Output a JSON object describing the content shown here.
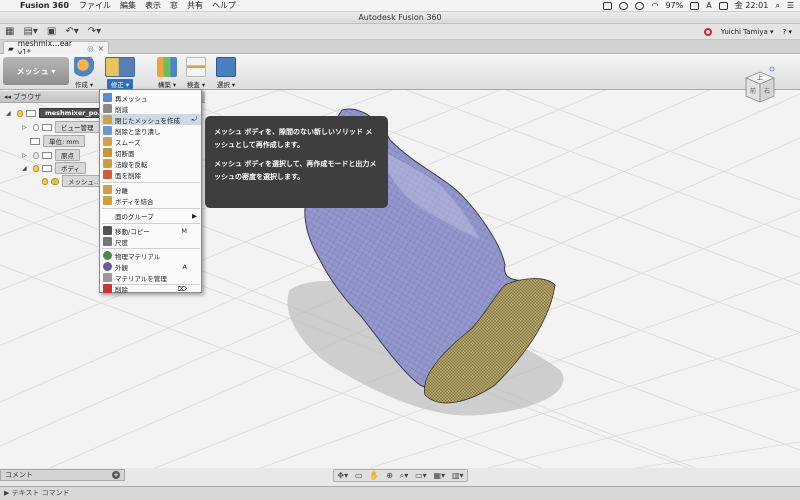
{
  "menubar": {
    "app_name": "Fusion 360",
    "items": [
      "ファイル",
      "編集",
      "表示",
      "窓",
      "共有",
      "ヘルプ"
    ],
    "battery": "97%",
    "input_mode": "A",
    "clock": "金 22:01"
  },
  "window": {
    "title": "Autodesk Fusion 360"
  },
  "qat": {
    "user": "Yuichi Tamiya ▾",
    "help": "? ▾"
  },
  "document_tab": {
    "label": "meshmix…ear v1*"
  },
  "toolbar": {
    "workspace": "メッシュ ▾",
    "buttons": [
      {
        "label": "作成 ▾"
      },
      {
        "label": "修正 ▾"
      },
      {
        "label": "構築 ▾"
      },
      {
        "label": "検査 ▾"
      },
      {
        "label": "選択 ▾"
      }
    ]
  },
  "browser": {
    "title": "◂◂ ブラウザ",
    "root": "meshmixer_po…",
    "view_settings": "ビュー管理",
    "units": "単位: mm",
    "origin": "原点",
    "bodies": "ボディ",
    "mesh": "メッシュ…"
  },
  "modify_menu": {
    "items": [
      {
        "label": "再メッシュ",
        "shortcut": "",
        "color": "#5a8fd0"
      },
      {
        "label": "削減",
        "shortcut": "",
        "color": "#8a8a8a"
      },
      {
        "label": "閉じたメッシュを作成",
        "shortcut": "⤾",
        "color": "#d0a04a",
        "highlighted": true
      },
      {
        "label": "削除と塗り潰し",
        "shortcut": "",
        "color": "#6a9ad0"
      },
      {
        "label": "スムーズ",
        "shortcut": "",
        "color": "#d0a24a"
      },
      {
        "label": "切断面",
        "shortcut": "",
        "color": "#c8953a"
      },
      {
        "label": "法線を反転",
        "shortcut": "",
        "color": "#d49a3a"
      },
      {
        "label": "面を削除",
        "shortcut": "",
        "color": "#d45a3a"
      },
      {
        "label": "分離",
        "shortcut": "",
        "color": "#cfa040"
      },
      {
        "label": "ボディを結合",
        "shortcut": "",
        "color": "#d0a040"
      },
      {
        "label": "面のグループ",
        "shortcut": "▶",
        "color": ""
      },
      {
        "label": "移動/コピー",
        "shortcut": "M",
        "color": "#555555"
      },
      {
        "label": "尺度",
        "shortcut": "",
        "color": "#777777"
      },
      {
        "label": "物理マテリアル",
        "shortcut": "",
        "color": "#4a8a4a"
      },
      {
        "label": "外観",
        "shortcut": "A",
        "color": "#6a5aa0"
      },
      {
        "label": "マテリアルを管理",
        "shortcut": "",
        "color": "#999999"
      },
      {
        "label": "削除",
        "shortcut": "⌦",
        "color": "#cc3333"
      }
    ]
  },
  "tooltip": {
    "line1": "メッシュ ボディを、隙間のない新しいソリッド メッシュとして再作成します。",
    "line2": "メッシュ ボディを選択して、再作成モードと出力メッシュの密度を選択します。"
  },
  "viewcube": {
    "top": "上",
    "front": "前",
    "right": "右"
  },
  "bottom": {
    "comments": "コメント",
    "text_command": "テキスト コマンド"
  },
  "colors": {
    "mesh_body": "#8f93c9",
    "mesh_cap": "#a99a5c",
    "highlight": "#2d6fbf",
    "tooltip_bg": "#3e3e3e"
  }
}
